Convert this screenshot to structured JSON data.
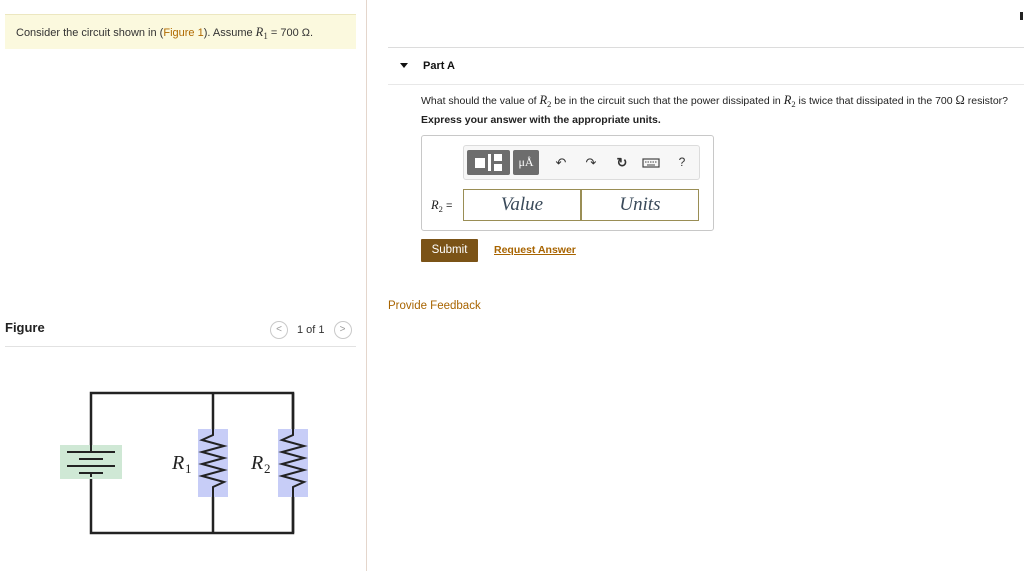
{
  "intro": {
    "prefix": "Consider the circuit shown in (",
    "figure_link": "Figure 1",
    "suffix": "). Assume ",
    "var": "R",
    "sub": "1",
    "value": " = 700 Ω."
  },
  "figure": {
    "title": "Figure",
    "count": "1 of 1",
    "prev": "<",
    "next": ">",
    "label_r1": "R",
    "label_r1_sub": "1",
    "label_r2": "R",
    "label_r2_sub": "2"
  },
  "partA": {
    "title": "Part A",
    "question_1": "What should the value of ",
    "question_var": "R",
    "question_sub": "2",
    "question_2": " be in the circuit such that the power dissipated in ",
    "question_3": " is twice that dissipated in the 700 ",
    "question_omega": "Ω",
    "question_4": " resistor?",
    "express": "Express your answer with the appropriate units.",
    "toolbar": {
      "units_btn": "μÅ",
      "undo_icon": "↶",
      "redo_icon": "↷",
      "reset_icon": "↻",
      "help": "?"
    },
    "input_label_var": "R",
    "input_label_sub": "2",
    "input_label_eq": " =",
    "value_placeholder": "Value",
    "units_placeholder": "Units",
    "submit": "Submit",
    "request_answer": "Request Answer"
  },
  "feedback": "Provide Feedback",
  "colors": {
    "accent_link": "#a86400",
    "submit_bg": "#7b5317",
    "intro_bg": "#fbf9de",
    "resistor_fill": "#c7cdf7",
    "battery_fill": "#cfe8d5"
  }
}
